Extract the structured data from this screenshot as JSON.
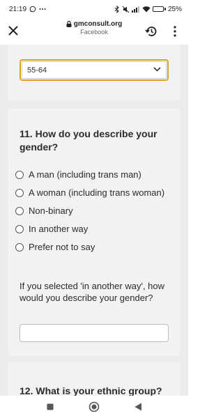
{
  "status_bar": {
    "time": "21:19",
    "battery": "25%",
    "battery_level": 0.25,
    "icons": [
      "whatsapp-icon",
      "more-dots-icon",
      "bluetooth-icon",
      "mute-icon",
      "signal-icon",
      "wifi-icon",
      "battery-icon"
    ]
  },
  "browser": {
    "url": "gmconsult.org",
    "subtitle": "Facebook",
    "icons": [
      "close-icon",
      "lock-icon",
      "history-icon",
      "more-vertical-icon"
    ]
  },
  "age_question": {
    "selected": "55-64"
  },
  "gender_question": {
    "title": "11. How do you describe your gender?",
    "options": [
      {
        "label": "A man (including trans man)"
      },
      {
        "label": "A woman (including trans woman)"
      },
      {
        "label": "Non-binary"
      },
      {
        "label": "In another way"
      },
      {
        "label": "Prefer not to say"
      }
    ],
    "follow_up_label": "If you selected 'in another way', how would you describe your gender?",
    "follow_up_value": ""
  },
  "ethnic_question": {
    "title": "12. What is your ethnic group?"
  },
  "colors": {
    "accent": "#d9a21b",
    "card": "#f2f2f2",
    "page": "#ececec"
  }
}
